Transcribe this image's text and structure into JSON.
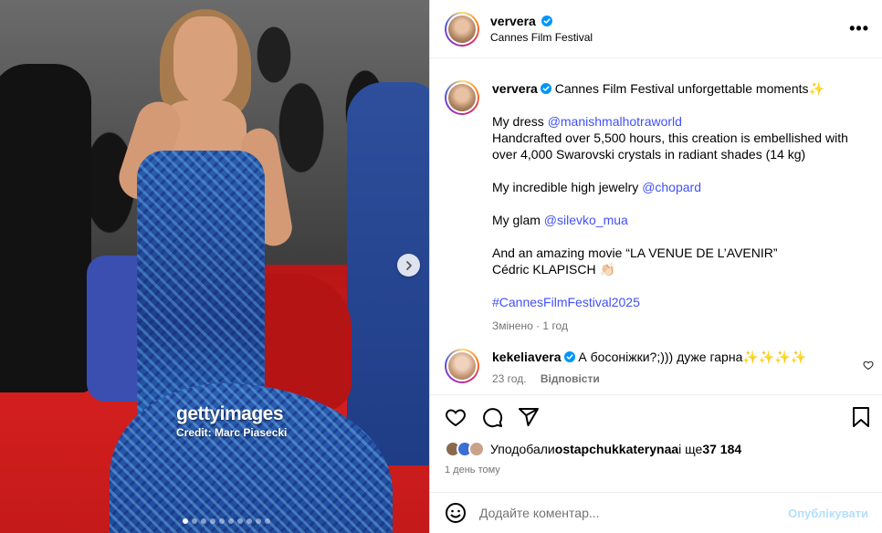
{
  "photo": {
    "watermark_logo": "gettyimages",
    "watermark_credit": "Credit: Marc Piasecki"
  },
  "header": {
    "username": "ververa",
    "location": "Cannes Film Festival"
  },
  "caption": {
    "username": "ververa",
    "line1": "Cannes Film Festival unforgettable moments✨",
    "dress_prefix": "My dress ",
    "dress_link": "@manishmalhotraworld",
    "dress_desc": "Handcrafted over 5,500 hours, this creation is embellished with over 4,000 Swarovski crystals in radiant shades (14 kg)",
    "jewelry_prefix": "My incredible high jewelry ",
    "jewelry_link": "@chopard",
    "glam_prefix": "My glam ",
    "glam_link": "@silevko_mua",
    "movie_line": "And an amazing movie “LA VENUE DE L’AVENIR”",
    "director_line": "Cédric KLAPISCH 👏🏻",
    "hashtag": "#CannesFilmFestival2025",
    "meta": "Змінено · 1 год"
  },
  "comment": {
    "username": "kekeliavera",
    "text": "А босоніжки?;))) дуже гарна✨✨✨✨",
    "time": "23 год.",
    "reply": "Відповісти"
  },
  "likes": {
    "prefix": "Уподобали ",
    "user": "ostapchukkaterynaa",
    "middle": " і ще ",
    "count": "37 184"
  },
  "posted_time": "1 день тому",
  "add_comment": {
    "placeholder": "Додайте коментар...",
    "publish": "Опублікувати"
  },
  "colors": {
    "link": "#4150f7",
    "verified": "#0095f6",
    "muted": "#737373",
    "publish_disabled": "#b2dffc"
  }
}
